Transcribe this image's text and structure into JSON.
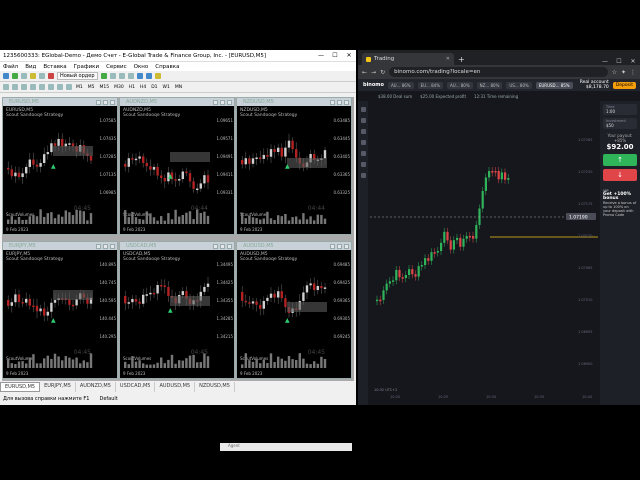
{
  "mt4": {
    "title": "1235600333: EGlobal-Demo - Демо Счет - E-Global Trade & Finance Group, Inc. - [EURUSD,M5]",
    "menu": [
      "Файл",
      "Вид",
      "Вставка",
      "Графики",
      "Сервис",
      "Окно",
      "Справка"
    ],
    "new_order": "Новый ордер",
    "timeframes": [
      "M1",
      "M5",
      "M15",
      "M30",
      "H1",
      "H4",
      "D1",
      "W1",
      "MN"
    ],
    "charts": [
      {
        "title": "EURUSD,M5",
        "symbol": "EURUSD,M5",
        "strategy": "Scout Sandooqe Strategy",
        "clock": "04:45",
        "osc": "ScoutVolumes",
        "date": "9 Feb 2023",
        "prices": [
          "1.07585",
          "1.07435",
          "1.07285",
          "1.07135",
          "1.06985"
        ]
      },
      {
        "title": "AUDNZD,M5",
        "symbol": "AUDNZD,M5",
        "strategy": "Scout Sandooqe Strategy",
        "clock": "04:44",
        "osc": "ScoutVolumes",
        "date": "9 Feb 2023",
        "prices": [
          "1.09651",
          "1.09571",
          "1.09491",
          "1.09411",
          "1.09331"
        ]
      },
      {
        "title": "NZDUSD,M5",
        "symbol": "NZDUSD,M5",
        "strategy": "Scout Sandooqe Strategy",
        "clock": "04:44",
        "osc": "ScoutVolumes",
        "date": "9 Feb 2023",
        "prices": [
          "0.63485",
          "0.63445",
          "0.63405",
          "0.63365",
          "0.63325"
        ]
      },
      {
        "title": "EURJPY,M5",
        "symbol": "EURJPY,M5",
        "strategy": "Scout Sandooqe Strategy",
        "clock": "04:45",
        "osc": "ScoutVolumes",
        "date": "9 Feb 2023",
        "prices": [
          "140.895",
          "140.745",
          "140.595",
          "140.445",
          "140.295"
        ]
      },
      {
        "title": "USDCAD,M5",
        "symbol": "USDCAD,M5",
        "strategy": "Scout Sandooqe Strategy",
        "clock": "04:45",
        "osc": "ScoutVolumes",
        "date": "9 Feb 2023",
        "prices": [
          "1.34495",
          "1.34425",
          "1.34355",
          "1.34285",
          "1.34215"
        ]
      },
      {
        "title": "AUDUSD,M5",
        "symbol": "AUDUSD,M5",
        "strategy": "Scout Sandooqe Strategy",
        "clock": "04:45",
        "osc": "ScoutVolumes",
        "date": "9 Feb 2023",
        "prices": [
          "0.69485",
          "0.69425",
          "0.69365",
          "0.69305",
          "0.69245"
        ]
      }
    ],
    "tabs": [
      "EURUSD,M5",
      "EURJPY,M5",
      "AUDNZD,M5",
      "USDCAD,M5",
      "AUDUSD,M5",
      "NZDUSD,M5"
    ],
    "status_help": "Для вызова справки нажмите F1",
    "status_profile": "Default",
    "notification": "Agent"
  },
  "browser": {
    "tab_title": "Trading",
    "url": "binomo.com/trading?locale=en",
    "header_pills": [
      "AU... 86%",
      "EU... 84%",
      "AU... 80%",
      "NZ... 80%",
      "US... 80%",
      "EURUSD... 85%"
    ],
    "logo": "binomo",
    "balance_label": "Real account",
    "balance": "$8,178.70",
    "deposit_label": "Deposit",
    "stats": [
      "$38.00",
      "$25.00",
      "12:31",
      "Deal sum",
      "Expected profit",
      "Time remaining"
    ],
    "time_label": "Time",
    "time_value": "1:00",
    "amount_label": "Investment",
    "amount_value": "$50",
    "payout_label": "Your payout: +85%",
    "payout_value": "$92.00",
    "promo_title": "Get +100% bonus",
    "promo_text": "Receive a bonus of up to 100% on your deposit with Promo Code",
    "vip": "VIP",
    "price_tag": "1.07190",
    "axis_times": [
      "10:20",
      "10:25",
      "10:30",
      "10:35",
      "10:40"
    ],
    "footer": "10:32 UTC+2",
    "ticks": [
      "1.07285",
      "1.07230",
      "1.07175",
      "1.07120",
      "1.07065",
      "1.07010",
      "1.06955",
      "1.06900"
    ]
  }
}
